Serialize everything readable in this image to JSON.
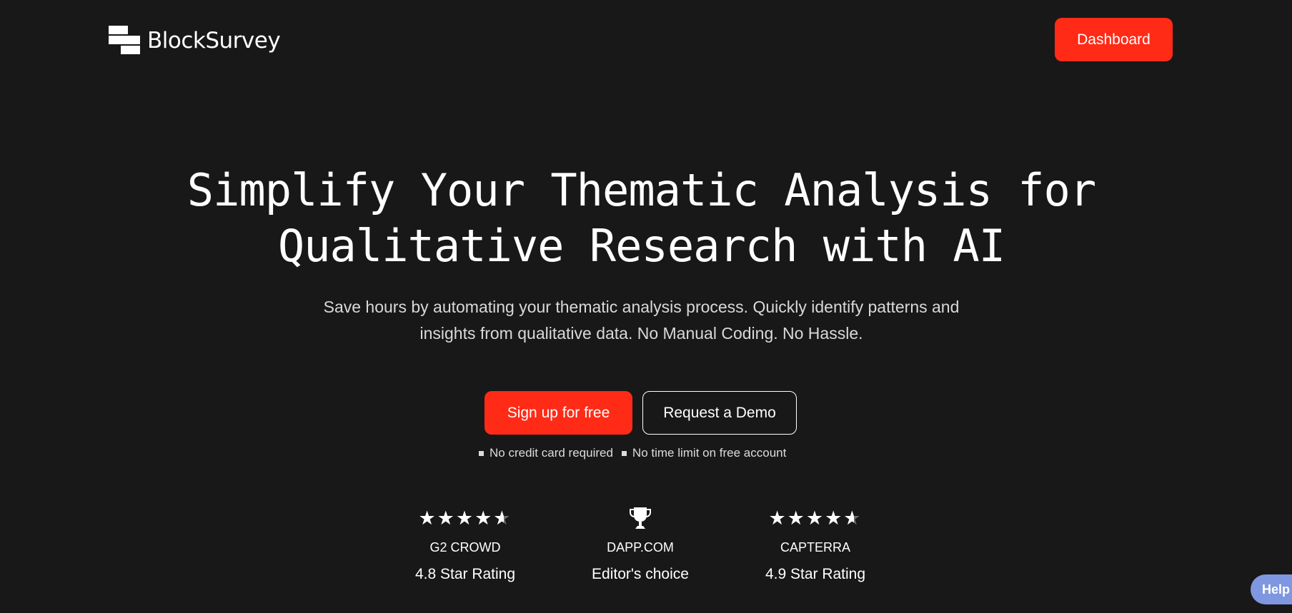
{
  "header": {
    "logo_text": "BlockSurvey",
    "dashboard_label": "Dashboard"
  },
  "hero": {
    "title_line1": "Simplify Your Thematic Analysis for",
    "title_line2": "Qualitative Research with AI",
    "subtitle_line1": "Save hours by automating your thematic analysis process. Quickly identify patterns and",
    "subtitle_line2": "insights from qualitative data. No Manual Coding. No Hassle."
  },
  "cta": {
    "signup_label": "Sign up for free",
    "demo_label": "Request a Demo"
  },
  "notes": [
    "No credit card required",
    "No time limit on free account"
  ],
  "ratings": [
    {
      "name": "G2 CROWD",
      "value": "4.8 Star Rating",
      "icon": "stars-icon",
      "stars": 4.5
    },
    {
      "name": "DAPP.COM",
      "value": "Editor's choice",
      "icon": "trophy-icon"
    },
    {
      "name": "CAPTERRA",
      "value": "4.9 Star Rating",
      "icon": "stars-icon",
      "stars": 4.5
    }
  ],
  "help": {
    "label": "Help"
  },
  "colors": {
    "background": "#181818",
    "accent": "#ff2b17",
    "help": "#7f97e0"
  }
}
